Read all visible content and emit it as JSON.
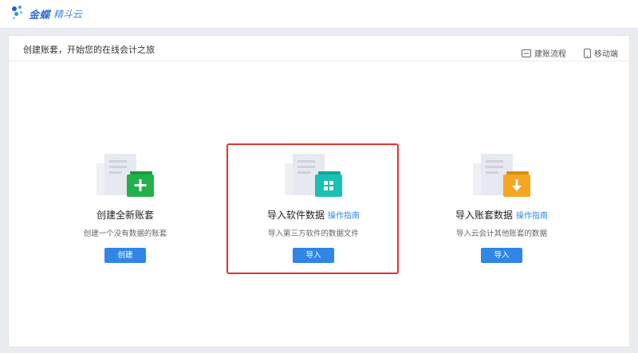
{
  "header": {
    "brand": "金蝶",
    "product": "精斗云"
  },
  "card": {
    "title": "创建账套，开始您的在线会计之旅",
    "links": [
      {
        "label": "建账流程",
        "icon": "flow-chart-icon"
      },
      {
        "label": "移动端",
        "icon": "mobile-icon"
      }
    ]
  },
  "options": [
    {
      "title": "创建全新账套",
      "guide": "",
      "desc": "创建一个没有数据的账套",
      "button": "创建",
      "badge_color": "#22b04b",
      "badge_icon": "plus-icon"
    },
    {
      "title": "导入软件数据",
      "guide": "操作指南",
      "desc": "导入第三方软件的数据文件",
      "button": "导入",
      "badge_color": "#19c0b4",
      "badge_icon": "grid-icon"
    },
    {
      "title": "导入账套数据",
      "guide": "操作指南",
      "desc": "导入云会计其他账套的数据",
      "button": "导入",
      "badge_color": "#f5a623",
      "badge_icon": "download-arrow-icon"
    }
  ],
  "colors": {
    "accent": "#2f86e6",
    "highlight": "#e3312f"
  }
}
